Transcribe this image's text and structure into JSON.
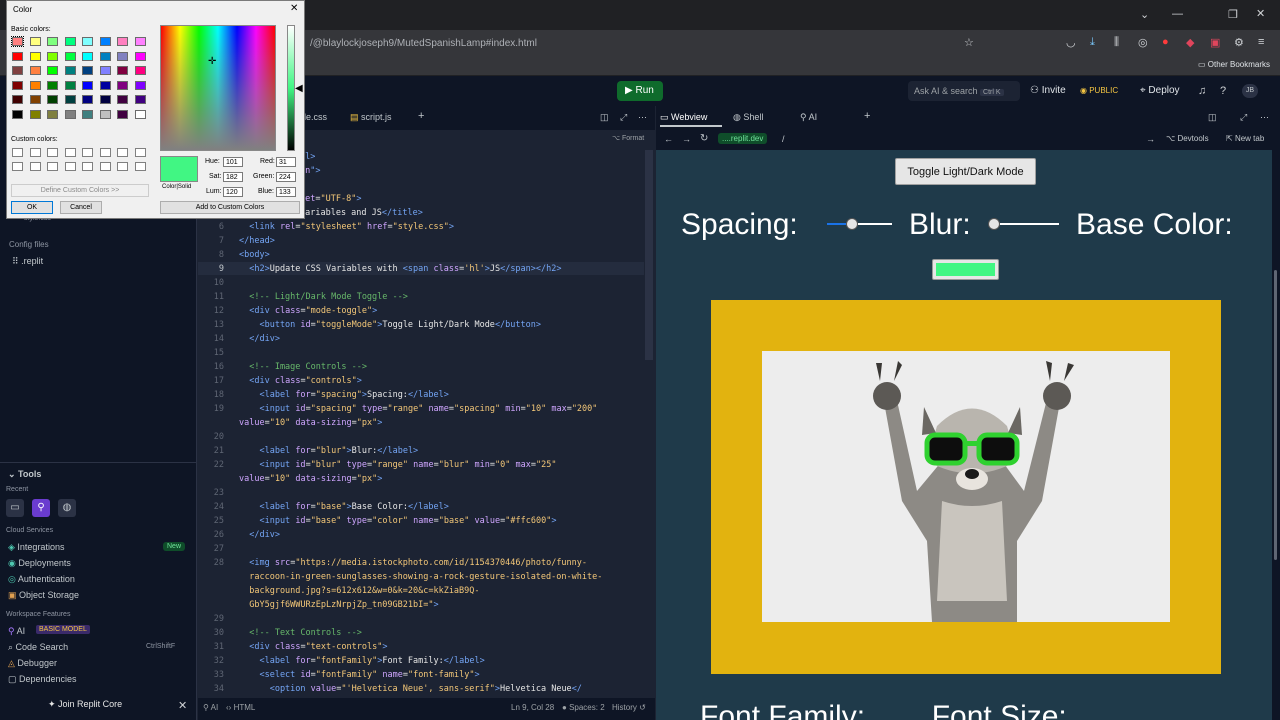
{
  "browser": {
    "url": "/@blaylockjoseph9/MutedSpanishLamp#index.html",
    "bookmark": "Other Bookmarks"
  },
  "topbar": {
    "run": "Run",
    "ask_ai": "Ask AI & search",
    "ask_ai_shortcut": "Ctrl K",
    "invite": "Invite",
    "public": "PUBLIC",
    "deploy": "Deploy",
    "avatar": "JB"
  },
  "sidebar": {
    "stylesheet_file": "style.css",
    "config_files_label": "Config files",
    "replit_file": ".replit",
    "tools_label": "Tools",
    "recent_label": "Recent",
    "cloud_services_label": "Cloud Services",
    "cloud_items": [
      "Integrations",
      "Deployments",
      "Authentication",
      "Object Storage"
    ],
    "new_badge": "New",
    "workspace_label": "Workspace Features",
    "workspace_items": [
      "AI",
      "Code Search",
      "Debugger",
      "Dependencies"
    ],
    "ai_badge": "BASIC MODEL",
    "code_search_shortcut": "CtrlShiftF",
    "join_core": "Join Replit Core"
  },
  "editor": {
    "tabs": [
      "le.css",
      "script.js"
    ],
    "format_label": "Format",
    "status": {
      "mode": "AI",
      "lang": "HTML",
      "position": "Ln 9, Col 28",
      "spaces": "Spaces: 2",
      "history": "History"
    }
  },
  "preview": {
    "tabs": [
      "Webview",
      "Shell",
      "AI"
    ],
    "url_host": "....replit.dev",
    "url_path": "/",
    "devtools": "Devtools",
    "new_tab": "New tab",
    "toggle_button": "Toggle Light/Dark Mode",
    "spacing_label": "Spacing:",
    "blur_label": "Blur:",
    "base_color_label": "Base Color:",
    "base_color_value": "#41f683",
    "frame_color": "#e2b30f",
    "spacing_value_fraction": 0.38,
    "blur_value_fraction": 0.0,
    "bottom_partial": "Font Family:        Font Size:"
  },
  "color_dialog": {
    "title": "Color",
    "basic_label": "Basic colors:",
    "custom_label": "Custom colors:",
    "define_button": "Define Custom Colors >>",
    "ok": "OK",
    "cancel": "Cancel",
    "color_solid_label": "Color|Solid",
    "add_custom": "Add to Custom Colors",
    "hue_label": "Hue:",
    "hue": "101",
    "sat_label": "Sat:",
    "sat": "182",
    "lum_label": "Lum:",
    "lum": "120",
    "red_label": "Red:",
    "red": "31",
    "green_label": "Green:",
    "green": "224",
    "blue_label": "Blue:",
    "blue": "133",
    "current_color": "#41f683"
  }
}
